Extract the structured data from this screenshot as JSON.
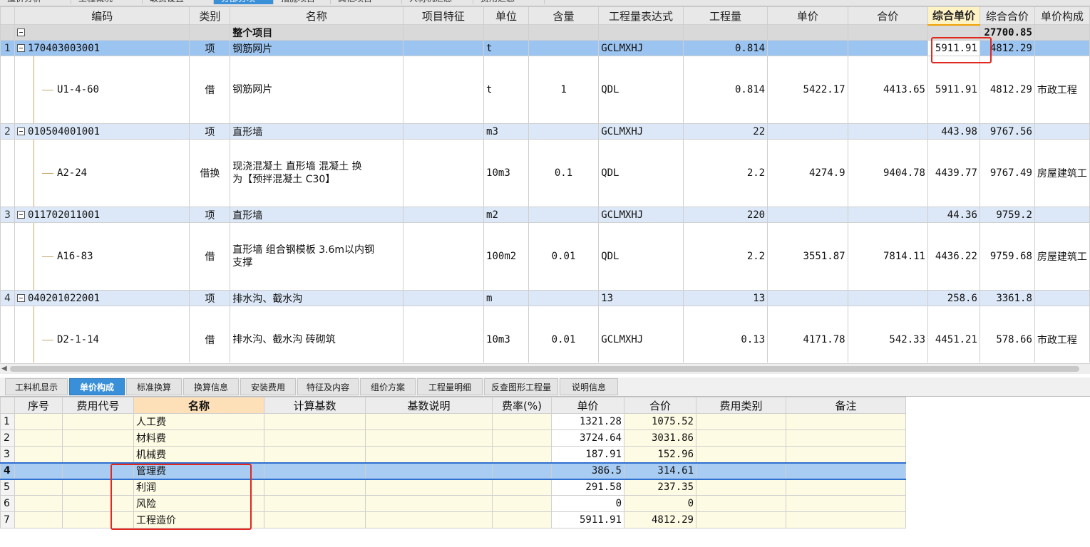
{
  "top_tabs": [
    {
      "label": "造价分析",
      "active": false
    },
    {
      "label": "工程概况",
      "active": false
    },
    {
      "label": "取费设置",
      "active": false
    },
    {
      "label": "分部分项",
      "active": true
    },
    {
      "label": "措施项目",
      "active": false
    },
    {
      "label": "其他项目",
      "active": false
    },
    {
      "label": "人材机汇总",
      "active": false
    },
    {
      "label": "费用汇总",
      "active": false
    }
  ],
  "grid": {
    "headers": [
      "编码",
      "类别",
      "名称",
      "项目特征",
      "单位",
      "含量",
      "工程量表达式",
      "工程量",
      "单价",
      "合价",
      "综合单价",
      "综合合价",
      "单价构成"
    ],
    "highlight_header": "综合单价",
    "group_row": {
      "name": "整个项目",
      "total": "27700.85"
    },
    "items": [
      {
        "num": "1",
        "code": "170403003001",
        "type": "项",
        "name": "钢筋网片",
        "unit": "t",
        "expr": "GCLMXHJ",
        "qty": "0.814",
        "uprice": "5911.91",
        "total": "4812.29",
        "sub": {
          "code": "U1-4-60",
          "type": "借",
          "name": "钢筋网片",
          "unit": "t",
          "content": "1",
          "expr": "QDL",
          "qty": "0.814",
          "price": "5422.17",
          "amount": "4413.65",
          "uprice": "5911.91",
          "total": "4812.29",
          "comp": "市政工程"
        }
      },
      {
        "num": "2",
        "code": "010504001001",
        "type": "项",
        "name": "直形墙",
        "unit": "m3",
        "expr": "GCLMXHJ",
        "qty": "22",
        "uprice": "443.98",
        "total": "9767.56",
        "sub": {
          "code": "A2-24",
          "type": "借换",
          "name": "现浇混凝土 直形墙 混凝土  换",
          "name2": "为【预拌混凝土 C30】",
          "unit": "10m3",
          "content": "0.1",
          "expr": "QDL",
          "qty": "2.2",
          "price": "4274.9",
          "amount": "9404.78",
          "uprice": "4439.77",
          "total": "9767.49",
          "comp": "房屋建筑工"
        }
      },
      {
        "num": "3",
        "code": "011702011001",
        "type": "项",
        "name": "直形墙",
        "unit": "m2",
        "expr": "GCLMXHJ",
        "qty": "220",
        "uprice": "44.36",
        "total": "9759.2",
        "sub": {
          "code": "A16-83",
          "type": "借",
          "name": "直形墙 组合钢模板 3.6m以内钢",
          "name2": "支撑",
          "unit": "100m2",
          "content": "0.01",
          "expr": "QDL",
          "qty": "2.2",
          "price": "3551.87",
          "amount": "7814.11",
          "uprice": "4436.22",
          "total": "9759.68",
          "comp": "房屋建筑工"
        }
      },
      {
        "num": "4",
        "code": "040201022001",
        "type": "项",
        "name": "排水沟、截水沟",
        "unit": "m",
        "expr": "13",
        "qty": "13",
        "uprice": "258.6",
        "total": "3361.8",
        "sub": {
          "code": "D2-1-14",
          "type": "借",
          "name": "排水沟、截水沟 砖砌筑",
          "unit": "10m3",
          "content": "0.01",
          "expr": "GCLMXHJ",
          "qty": "0.13",
          "price": "4171.78",
          "amount": "542.33",
          "uprice": "4451.21",
          "total": "578.66",
          "comp": "市政工程"
        }
      }
    ]
  },
  "bottom_tabs": [
    "工料机显示",
    "单价构成",
    "标准换算",
    "换算信息",
    "安装费用",
    "特征及内容",
    "组价方案",
    "工程量明细",
    "反查图形工程量",
    "说明信息"
  ],
  "bottom_active": "单价构成",
  "lower": {
    "headers": [
      "序号",
      "费用代号",
      "名称",
      "计算基数",
      "基数说明",
      "费率(%)",
      "单价",
      "合价",
      "费用类别",
      "备注"
    ],
    "highlight_header": "名称",
    "rows": [
      {
        "n": "1",
        "name": "人工费",
        "uprice": "1321.28",
        "total": "1075.52"
      },
      {
        "n": "2",
        "name": "材料费",
        "uprice": "3724.64",
        "total": "3031.86"
      },
      {
        "n": "3",
        "name": "机械费",
        "uprice": "187.91",
        "total": "152.96"
      },
      {
        "n": "4",
        "name": "管理费",
        "uprice": "386.5",
        "total": "314.61"
      },
      {
        "n": "5",
        "name": "利润",
        "uprice": "291.58",
        "total": "237.35"
      },
      {
        "n": "6",
        "name": "风险",
        "uprice": "0",
        "total": "0"
      },
      {
        "n": "7",
        "name": "工程造价",
        "uprice": "5911.91",
        "total": "4812.29"
      }
    ],
    "selected_row": "4"
  },
  "colors": {
    "accent": "#3a8fd9",
    "selected_row": "#9cc4f0",
    "item_row": "#dce8f7",
    "annotation": "#e0281e"
  }
}
